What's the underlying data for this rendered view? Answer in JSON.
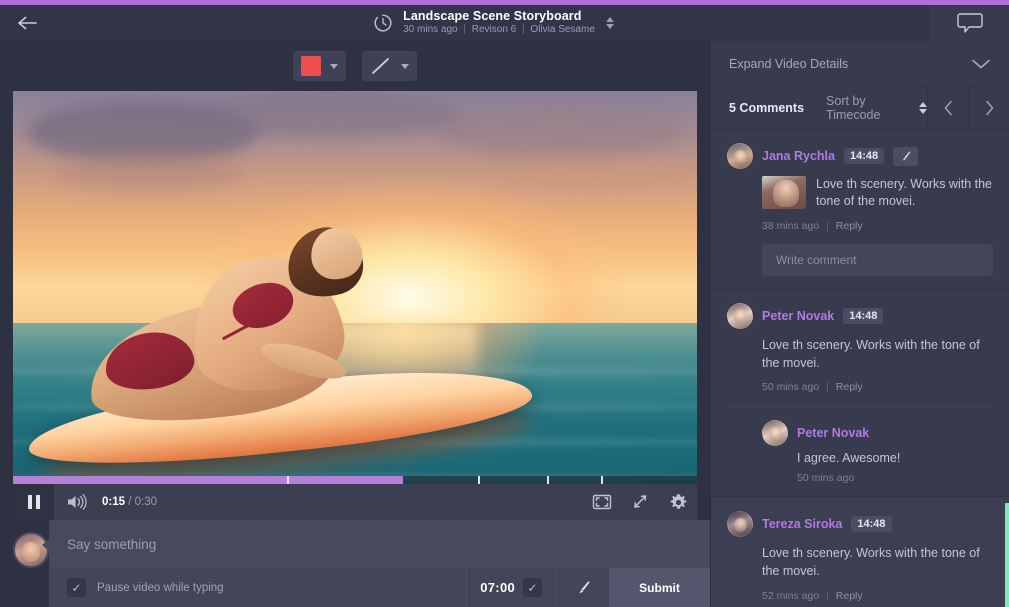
{
  "topbar": {
    "back_icon": "arrow-left-icon",
    "clock_icon": "clock-icon",
    "title": "Landscape Scene Storyboard",
    "meta_time": "30 mins ago",
    "meta_revision": "Revison 6",
    "meta_author": "Olivia Sesame",
    "separator": "|",
    "chat_icon": "chat-bubble-icon",
    "accent_color": "#b06fd8"
  },
  "toolbar": {
    "color_swatch": "#ef4e4e",
    "color_caret": "chevron-down-icon",
    "stroke_icon": "line-tool-icon",
    "stroke_caret": "chevron-down-icon"
  },
  "player": {
    "pause_icon": "pause-icon",
    "volume_icon": "volume-icon",
    "current_time": "0:15",
    "time_separator": "/",
    "duration": "0:30",
    "progress_percent": 57,
    "tick_positions": [
      40,
      68,
      78,
      86
    ],
    "fit_icon": "fit-frame-icon",
    "resize_icon": "resize-diagonal-icon",
    "settings_icon": "gear-icon",
    "progress_color": "#b581d8"
  },
  "composer": {
    "avatar": "user-avatar",
    "input_placeholder": "Say something",
    "checkbox_icon": "check-icon",
    "pause_label": "Pause video while typing",
    "timecode": "07:00",
    "timecode_check_icon": "check-icon",
    "brush_icon": "brush-icon",
    "submit_label": "Submit"
  },
  "panel": {
    "expand_label": "Expand Video Details",
    "expand_icon": "chevron-down-icon",
    "comments_count": "5 Comments",
    "sort_label": "Sort by Timecode",
    "sort_icon": "sort-arrows-icon",
    "prev_icon": "chevron-left-icon",
    "next_icon": "chevron-right-icon",
    "highlight_color": "#86e8b4",
    "comments": [
      {
        "author": "Jana Rychla",
        "timecode": "14:48",
        "brush_icon": "brush-icon",
        "has_thumbnail": true,
        "text": "Love th scenery. Works with the tone of the movei.",
        "posted": "38 mins ago",
        "reply_label": "Reply",
        "write_placeholder": "Write comment"
      },
      {
        "author": "Peter Novak",
        "timecode": "14:48",
        "text": "Love th scenery. Works with the tone of the movei.",
        "posted": "50 mins ago",
        "reply_label": "Reply",
        "reply": {
          "author": "Peter Novak",
          "text": "I agree. Awesome!",
          "posted": "50 mins ago"
        }
      },
      {
        "author": "Tereza Siroka",
        "timecode": "14:48",
        "text": "Love th scenery. Works with the tone of the movei.",
        "posted": "52 mins ago",
        "reply_label": "Reply"
      }
    ]
  }
}
